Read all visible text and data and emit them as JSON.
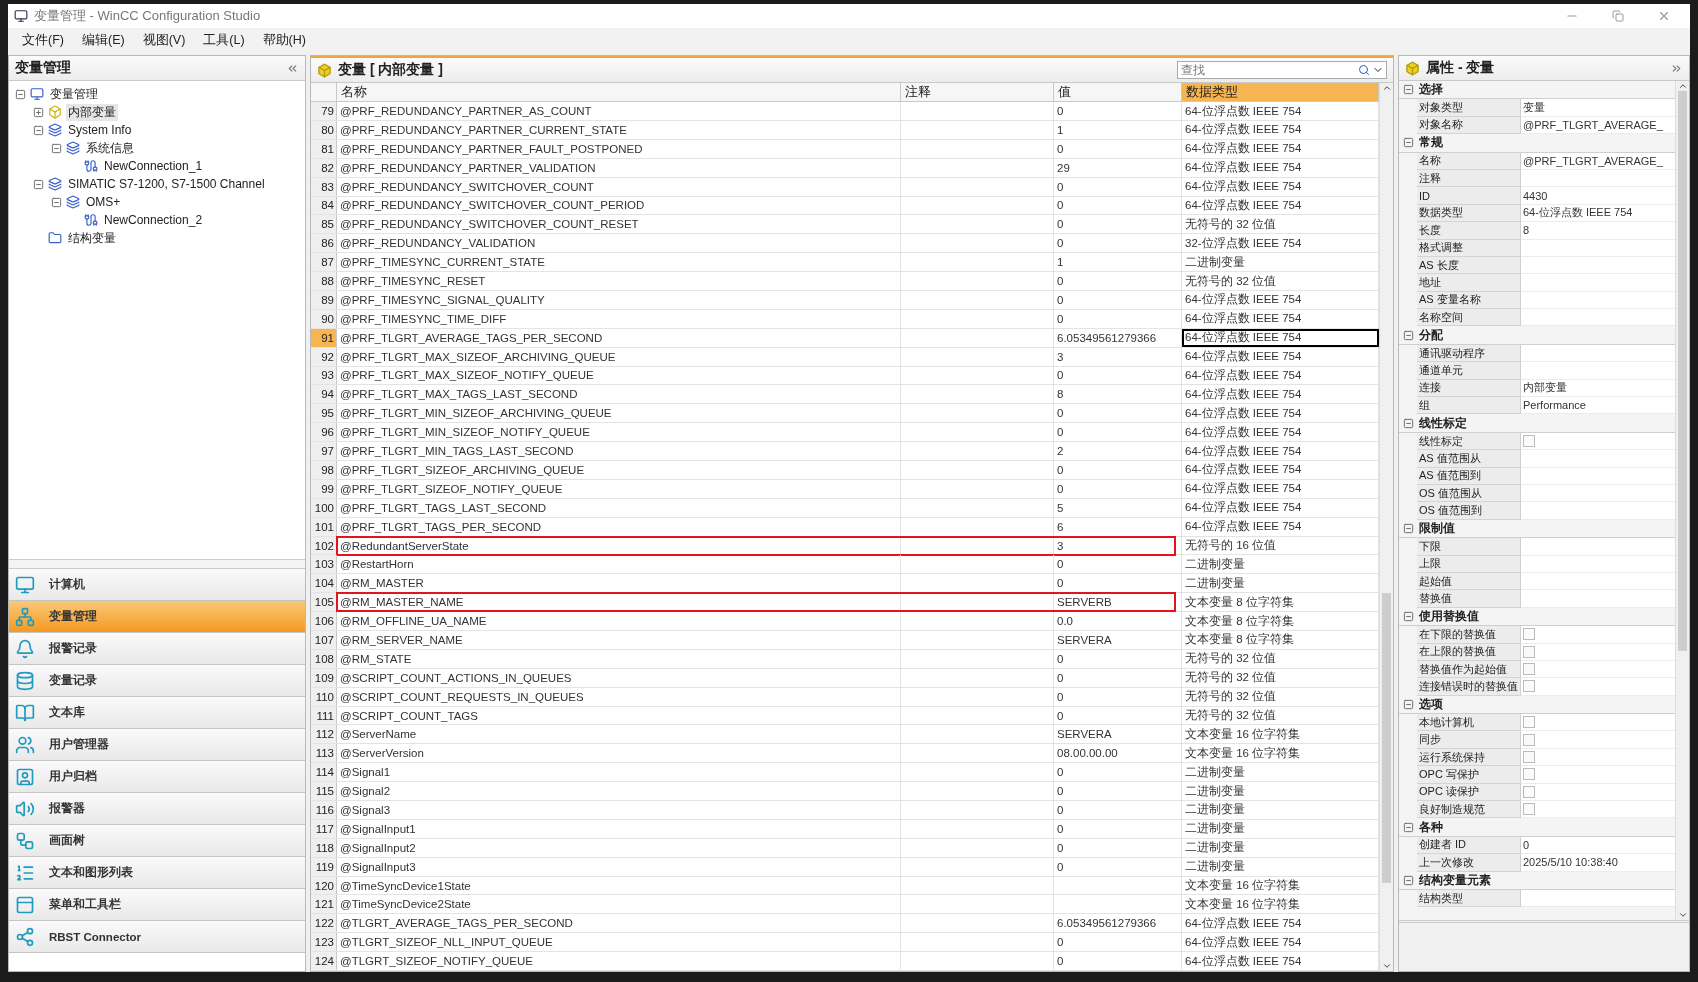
{
  "window": {
    "title": "变量管理 - WinCC Configuration Studio"
  },
  "menu": [
    "文件(F)",
    "编辑(E)",
    "视图(V)",
    "工具(L)",
    "帮助(H)"
  ],
  "navigator": {
    "title": "变量管理",
    "tree": [
      {
        "label": "变量管理",
        "expanded": true,
        "selected": false,
        "children": [
          {
            "label": "内部变量",
            "expanded": false,
            "selected": true
          },
          {
            "label": "System Info",
            "expanded": true,
            "selected": false,
            "children": [
              {
                "label": "系统信息",
                "expanded": true,
                "selected": false,
                "children": [
                  {
                    "label": "NewConnection_1",
                    "selected": false
                  }
                ]
              }
            ]
          },
          {
            "label": "SIMATIC S7-1200, S7-1500 Channel",
            "expanded": true,
            "selected": false,
            "children": [
              {
                "label": "OMS+",
                "expanded": true,
                "selected": false,
                "children": [
                  {
                    "label": "NewConnection_2",
                    "selected": false
                  }
                ]
              }
            ]
          },
          {
            "label": "结构变量",
            "selected": false
          }
        ]
      }
    ],
    "nav_items": [
      {
        "label": "计算机",
        "selected": false
      },
      {
        "label": "变量管理",
        "selected": true
      },
      {
        "label": "报警记录",
        "selected": false
      },
      {
        "label": "变量记录",
        "selected": false
      },
      {
        "label": "文本库",
        "selected": false
      },
      {
        "label": "用户管理器",
        "selected": false
      },
      {
        "label": "用户归档",
        "selected": false
      },
      {
        "label": "报警器",
        "selected": false
      },
      {
        "label": "画面树",
        "selected": false
      },
      {
        "label": "文本和图形列表",
        "selected": false
      },
      {
        "label": "菜单和工具栏",
        "selected": false
      },
      {
        "label": "RBST Connector",
        "selected": false
      }
    ]
  },
  "table": {
    "title": "变量 [ 内部变量 ]",
    "search": {
      "placeholder": "查找"
    },
    "columns": [
      {
        "label": "名称",
        "selected": false
      },
      {
        "label": "注释",
        "selected": false
      },
      {
        "label": "值",
        "selected": false
      },
      {
        "label": "数据类型",
        "selected": true
      }
    ],
    "rows": [
      {
        "number": "79",
        "name": "@PRF_REDUNDANCY_PARTNER_AS_COUNT",
        "value": "0",
        "type": "64-位浮点数 IEEE 754",
        "selected": false,
        "annotated": false
      },
      {
        "number": "80",
        "name": "@PRF_REDUNDANCY_PARTNER_CURRENT_STATE",
        "value": "1",
        "type": "64-位浮点数 IEEE 754",
        "selected": false,
        "annotated": false
      },
      {
        "number": "81",
        "name": "@PRF_REDUNDANCY_PARTNER_FAULT_POSTPONED",
        "value": "0",
        "type": "64-位浮点数 IEEE 754",
        "selected": false,
        "annotated": false
      },
      {
        "number": "82",
        "name": "@PRF_REDUNDANCY_PARTNER_VALIDATION",
        "value": "29",
        "type": "64-位浮点数 IEEE 754",
        "selected": false,
        "annotated": false
      },
      {
        "number": "83",
        "name": "@PRF_REDUNDANCY_SWITCHOVER_COUNT",
        "value": "0",
        "type": "64-位浮点数 IEEE 754",
        "selected": false,
        "annotated": false
      },
      {
        "number": "84",
        "name": "@PRF_REDUNDANCY_SWITCHOVER_COUNT_PERIOD",
        "value": "0",
        "type": "64-位浮点数 IEEE 754",
        "selected": false,
        "annotated": false
      },
      {
        "number": "85",
        "name": "@PRF_REDUNDANCY_SWITCHOVER_COUNT_RESET",
        "value": "0",
        "type": "无符号的 32 位值",
        "selected": false,
        "annotated": false
      },
      {
        "number": "86",
        "name": "@PRF_REDUNDANCY_VALIDATION",
        "value": "0",
        "type": "32-位浮点数 IEEE 754",
        "selected": false,
        "annotated": false
      },
      {
        "number": "87",
        "name": "@PRF_TIMESYNC_CURRENT_STATE",
        "value": "1",
        "type": "二进制变量",
        "selected": false,
        "annotated": false
      },
      {
        "number": "88",
        "name": "@PRF_TIMESYNC_RESET",
        "value": "0",
        "type": "无符号的 32 位值",
        "selected": false,
        "annotated": false
      },
      {
        "number": "89",
        "name": "@PRF_TIMESYNC_SIGNAL_QUALITY",
        "value": "0",
        "type": "64-位浮点数 IEEE 754",
        "selected": false,
        "annotated": false
      },
      {
        "number": "90",
        "name": "@PRF_TIMESYNC_TIME_DIFF",
        "value": "0",
        "type": "64-位浮点数 IEEE 754",
        "selected": false,
        "annotated": false
      },
      {
        "number": "91",
        "name": "@PRF_TLGRT_AVERAGE_TAGS_PER_SECOND",
        "value": "6.05349561279366",
        "type": "64-位浮点数 IEEE 754",
        "selected": true,
        "annotated": false
      },
      {
        "number": "92",
        "name": "@PRF_TLGRT_MAX_SIZEOF_ARCHIVING_QUEUE",
        "value": "3",
        "type": "64-位浮点数 IEEE 754",
        "selected": false,
        "annotated": false
      },
      {
        "number": "93",
        "name": "@PRF_TLGRT_MAX_SIZEOF_NOTIFY_QUEUE",
        "value": "0",
        "type": "64-位浮点数 IEEE 754",
        "selected": false,
        "annotated": false
      },
      {
        "number": "94",
        "name": "@PRF_TLGRT_MAX_TAGS_LAST_SECOND",
        "value": "8",
        "type": "64-位浮点数 IEEE 754",
        "selected": false,
        "annotated": false
      },
      {
        "number": "95",
        "name": "@PRF_TLGRT_MIN_SIZEOF_ARCHIVING_QUEUE",
        "value": "0",
        "type": "64-位浮点数 IEEE 754",
        "selected": false,
        "annotated": false
      },
      {
        "number": "96",
        "name": "@PRF_TLGRT_MIN_SIZEOF_NOTIFY_QUEUE",
        "value": "0",
        "type": "64-位浮点数 IEEE 754",
        "selected": false,
        "annotated": false
      },
      {
        "number": "97",
        "name": "@PRF_TLGRT_MIN_TAGS_LAST_SECOND",
        "value": "2",
        "type": "64-位浮点数 IEEE 754",
        "selected": false,
        "annotated": false
      },
      {
        "number": "98",
        "name": "@PRF_TLGRT_SIZEOF_ARCHIVING_QUEUE",
        "value": "0",
        "type": "64-位浮点数 IEEE 754",
        "selected": false,
        "annotated": false
      },
      {
        "number": "99",
        "name": "@PRF_TLGRT_SIZEOF_NOTIFY_QUEUE",
        "value": "0",
        "type": "64-位浮点数 IEEE 754",
        "selected": false,
        "annotated": false
      },
      {
        "number": "100",
        "name": "@PRF_TLGRT_TAGS_LAST_SECOND",
        "value": "5",
        "type": "64-位浮点数 IEEE 754",
        "selected": false,
        "annotated": false
      },
      {
        "number": "101",
        "name": "@PRF_TLGRT_TAGS_PER_SECOND",
        "value": "6",
        "type": "64-位浮点数 IEEE 754",
        "selected": false,
        "annotated": false
      },
      {
        "number": "102",
        "name": "@RedundantServerState",
        "value": "3",
        "type": "无符号的 16 位值",
        "selected": false,
        "annotated": true
      },
      {
        "number": "103",
        "name": "@RestartHorn",
        "value": "0",
        "type": "二进制变量",
        "selected": false,
        "annotated": false
      },
      {
        "number": "104",
        "name": "@RM_MASTER",
        "value": "0",
        "type": "二进制变量",
        "selected": false,
        "annotated": false
      },
      {
        "number": "105",
        "name": "@RM_MASTER_NAME",
        "value": "SERVERB",
        "type": "文本变量 8 位字符集",
        "selected": false,
        "annotated": true
      },
      {
        "number": "106",
        "name": "@RM_OFFLINE_UA_NAME",
        "value": "0.0",
        "type": "文本变量 8 位字符集",
        "selected": false,
        "annotated": false
      },
      {
        "number": "107",
        "name": "@RM_SERVER_NAME",
        "value": "SERVERA",
        "type": "文本变量 8 位字符集",
        "selected": false,
        "annotated": false
      },
      {
        "number": "108",
        "name": "@RM_STATE",
        "value": "0",
        "type": "无符号的 32 位值",
        "selected": false,
        "annotated": false
      },
      {
        "number": "109",
        "name": "@SCRIPT_COUNT_ACTIONS_IN_QUEUES",
        "value": "0",
        "type": "无符号的 32 位值",
        "selected": false,
        "annotated": false
      },
      {
        "number": "110",
        "name": "@SCRIPT_COUNT_REQUESTS_IN_QUEUES",
        "value": "0",
        "type": "无符号的 32 位值",
        "selected": false,
        "annotated": false
      },
      {
        "number": "111",
        "name": "@SCRIPT_COUNT_TAGS",
        "value": "0",
        "type": "无符号的 32 位值",
        "selected": false,
        "annotated": false
      },
      {
        "number": "112",
        "name": "@ServerName",
        "value": "SERVERA",
        "type": "文本变量 16 位字符集",
        "selected": false,
        "annotated": false
      },
      {
        "number": "113",
        "name": "@ServerVersion",
        "value": "08.00.00.00",
        "type": "文本变量 16 位字符集",
        "selected": false,
        "annotated": false
      },
      {
        "number": "114",
        "name": "@Signal1",
        "value": "0",
        "type": "二进制变量",
        "selected": false,
        "annotated": false
      },
      {
        "number": "115",
        "name": "@Signal2",
        "value": "0",
        "type": "二进制变量",
        "selected": false,
        "annotated": false
      },
      {
        "number": "116",
        "name": "@Signal3",
        "value": "0",
        "type": "二进制变量",
        "selected": false,
        "annotated": false
      },
      {
        "number": "117",
        "name": "@SignalInput1",
        "value": "0",
        "type": "二进制变量",
        "selected": false,
        "annotated": false
      },
      {
        "number": "118",
        "name": "@SignalInput2",
        "value": "0",
        "type": "二进制变量",
        "selected": false,
        "annotated": false
      },
      {
        "number": "119",
        "name": "@SignalInput3",
        "value": "0",
        "type": "二进制变量",
        "selected": false,
        "annotated": false
      },
      {
        "number": "120",
        "name": "@TimeSyncDevice1State",
        "type": "文本变量 16 位字符集",
        "selected": false,
        "annotated": false
      },
      {
        "number": "121",
        "name": "@TimeSyncDevice2State",
        "type": "文本变量 16 位字符集",
        "selected": false,
        "annotated": false
      },
      {
        "number": "122",
        "name": "@TLGRT_AVERAGE_TAGS_PER_SECOND",
        "value": "6.05349561279366",
        "type": "64-位浮点数 IEEE 754",
        "selected": false,
        "annotated": false
      },
      {
        "number": "123",
        "name": "@TLGRT_SIZEOF_NLL_INPUT_QUEUE",
        "value": "0",
        "type": "64-位浮点数 IEEE 754",
        "selected": false,
        "annotated": false
      },
      {
        "number": "124",
        "name": "@TLGRT_SIZEOF_NOTIFY_QUEUE",
        "value": "0",
        "type": "64-位浮点数 IEEE 754",
        "selected": false,
        "annotated": false
      }
    ]
  },
  "properties": {
    "title": "属性 - 变量",
    "groups": [
      {
        "title": "选择",
        "expanded": true,
        "items": [
          {
            "kind": "text",
            "label": "对象类型",
            "value": "变量"
          },
          {
            "kind": "text",
            "label": "对象名称",
            "value": "@PRF_TLGRT_AVERAGE_"
          }
        ]
      },
      {
        "title": "常规",
        "expanded": true,
        "items": [
          {
            "kind": "text",
            "label": "名称",
            "value": "@PRF_TLGRT_AVERAGE_"
          },
          {
            "kind": "text",
            "label": "注释"
          },
          {
            "kind": "text",
            "label": "ID",
            "value": "4430"
          },
          {
            "kind": "text",
            "label": "数据类型",
            "value": "64-位浮点数 IEEE 754"
          },
          {
            "kind": "text",
            "label": "长度",
            "value": "8"
          },
          {
            "kind": "text",
            "label": "格式调整"
          },
          {
            "kind": "text",
            "label": "AS 长度"
          },
          {
            "kind": "text",
            "label": "地址"
          },
          {
            "kind": "text",
            "label": "AS 变量名称"
          },
          {
            "kind": "text",
            "label": "名称空间"
          }
        ]
      },
      {
        "title": "分配",
        "expanded": true,
        "items": [
          {
            "kind": "text",
            "label": "通讯驱动程序"
          },
          {
            "kind": "text",
            "label": "通道单元"
          },
          {
            "kind": "text",
            "label": "连接",
            "value": "内部变量"
          },
          {
            "kind": "text",
            "label": "组",
            "value": "Performance"
          }
        ]
      },
      {
        "title": "线性标定",
        "expanded": true,
        "items": [
          {
            "kind": "checkbox",
            "label": "线性标定",
            "checked": false
          },
          {
            "kind": "text",
            "label": "AS 值范围从"
          },
          {
            "kind": "text",
            "label": "AS 值范围到"
          },
          {
            "kind": "text",
            "label": "OS 值范围从"
          },
          {
            "kind": "text",
            "label": "OS 值范围到"
          }
        ]
      },
      {
        "title": "限制值",
        "expanded": true,
        "items": [
          {
            "kind": "text",
            "label": "下限"
          },
          {
            "kind": "text",
            "label": "上限"
          },
          {
            "kind": "text",
            "label": "起始值"
          },
          {
            "kind": "text",
            "label": "替换值"
          }
        ]
      },
      {
        "title": "使用替换值",
        "expanded": true,
        "items": [
          {
            "kind": "checkbox",
            "label": "在下限的替换值",
            "checked": false
          },
          {
            "kind": "checkbox",
            "label": "在上限的替换值",
            "checked": false
          },
          {
            "kind": "checkbox",
            "label": "替换值作为起始值",
            "checked": false
          },
          {
            "kind": "checkbox",
            "label": "连接错误时的替换值",
            "checked": false
          }
        ]
      },
      {
        "title": "选项",
        "expanded": true,
        "items": [
          {
            "kind": "checkbox",
            "label": "本地计算机",
            "checked": false
          },
          {
            "kind": "checkbox",
            "label": "同步",
            "checked": false
          },
          {
            "kind": "checkbox",
            "label": "运行系统保持",
            "checked": false
          },
          {
            "kind": "checkbox",
            "label": "OPC 写保护",
            "checked": false
          },
          {
            "kind": "checkbox",
            "label": "OPC 读保护",
            "checked": false
          },
          {
            "kind": "checkbox",
            "label": "良好制造规范",
            "checked": false
          }
        ]
      },
      {
        "title": "各种",
        "expanded": true,
        "items": [
          {
            "kind": "text",
            "label": "创建者 ID",
            "value": "0"
          },
          {
            "kind": "text",
            "label": "上一次修改",
            "value": "2025/5/10 10:38:40"
          }
        ]
      },
      {
        "title": "结构变量元素",
        "expanded": true,
        "items": [
          {
            "kind": "text",
            "label": "结构类型"
          }
        ]
      }
    ]
  }
}
